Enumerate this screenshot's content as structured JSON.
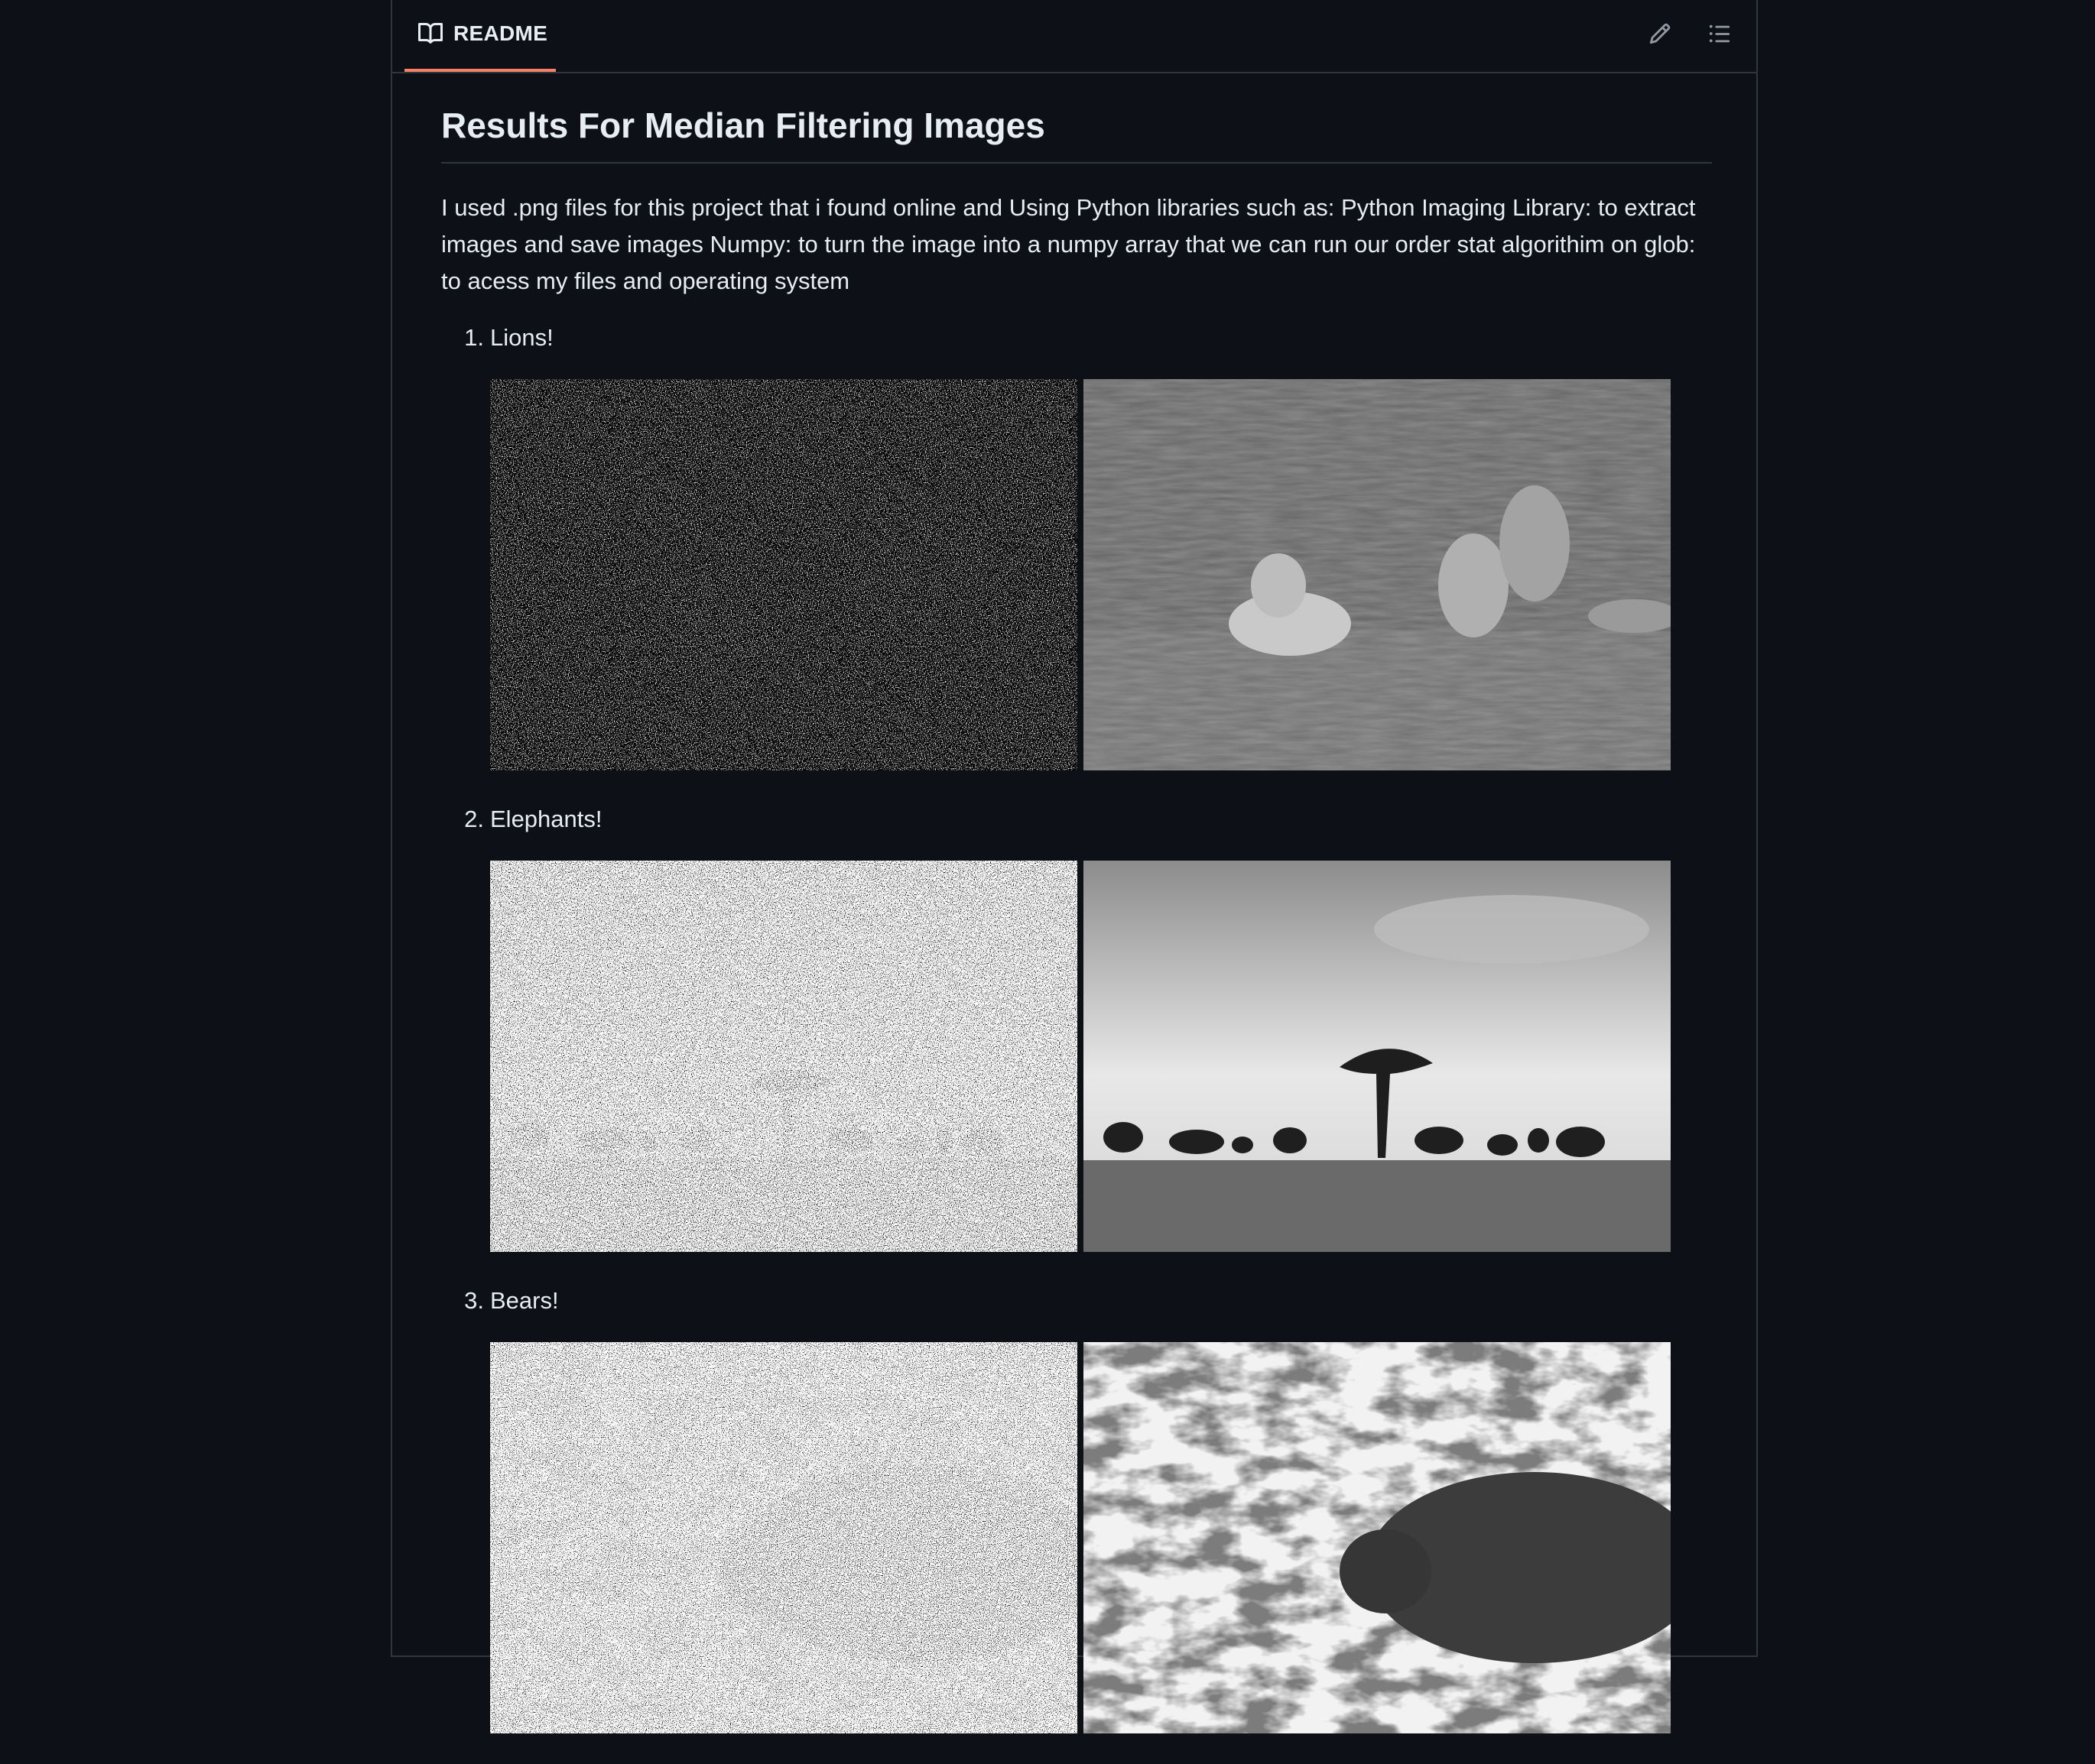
{
  "readme": {
    "tab_label": "README",
    "icons": {
      "tab": "book-icon",
      "edit": "pencil-icon",
      "toc": "list-icon"
    }
  },
  "article": {
    "title": "Results For Median Filtering Images",
    "intro": "I used .png files for this project that i found online and Using Python libraries such as: Python Imaging Library: to extract images and save images Numpy: to turn the image into a numpy array that we can run our order stat algorithim on glob: to acess my files and operating system",
    "items": [
      {
        "marker": "1.",
        "label": "Lions!"
      },
      {
        "marker": "2.",
        "label": "Elephants!"
      },
      {
        "marker": "3.",
        "label": "Bears!"
      }
    ]
  },
  "colors": {
    "background": "#0d1117",
    "border": "#30363d",
    "tab_underline": "#f78166",
    "text": "#e6edf3"
  }
}
